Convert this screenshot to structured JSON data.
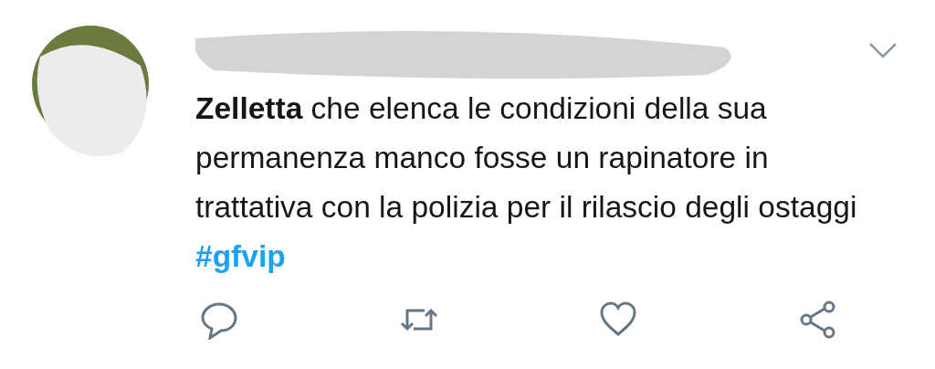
{
  "tweet": {
    "text": "**Zelletta** che elenca le condizioni della sua permanenza manco fosse un rapinatore in trattativa con la polizia per il rilascio degli ostaggi",
    "hashtag": "#gfvip"
  }
}
